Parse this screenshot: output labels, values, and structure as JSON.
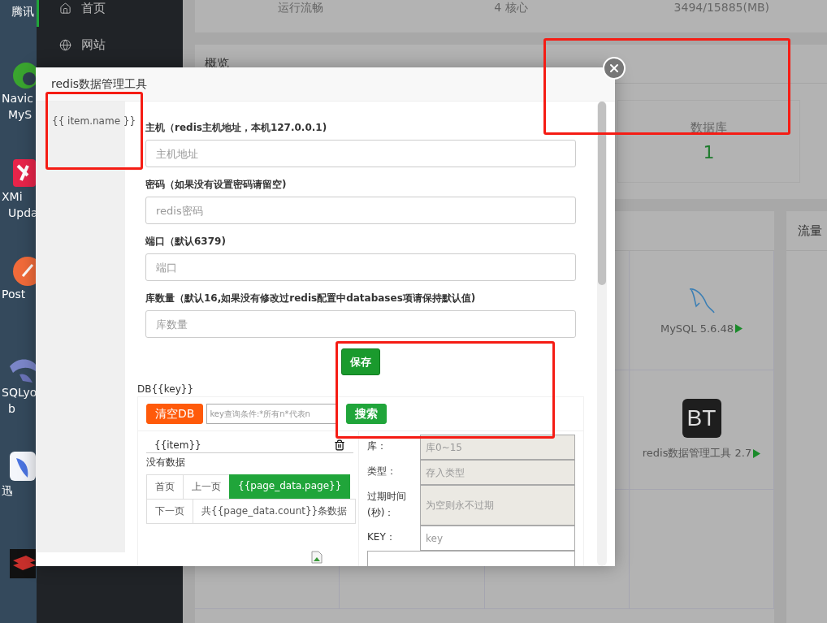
{
  "desktop_icons": [
    {
      "lines": [
        "腾讯"
      ]
    },
    {
      "kind": "green",
      "lines": [
        "Navic",
        "MyS"
      ]
    },
    {
      "kind": "red",
      "lines": [
        "XMi",
        "Upda"
      ]
    },
    {
      "kind": "orange",
      "lines": [
        "Post"
      ]
    },
    {
      "kind": "dolphin",
      "lines": [
        "SQLyo",
        "b"
      ]
    },
    {
      "kind": "bird",
      "lines": [
        "迅"
      ]
    },
    {
      "kind": "stack"
    }
  ],
  "sidebar": {
    "items": [
      {
        "label": "首页",
        "selected": true
      },
      {
        "label": "网站",
        "selected": false
      }
    ]
  },
  "stats": [
    "运行流畅",
    "4 核心",
    "3494/15885(MB)"
  ],
  "overview": {
    "title": "概览",
    "cards": [
      {
        "label": "数据库",
        "value": "1"
      }
    ]
  },
  "software": [
    {
      "name": "MySQL 5.6.48",
      "kind": "dolphin"
    },
    {
      "name": "redis数据管理工具 2.7",
      "kind": "logo",
      "logo_text": "BT"
    }
  ],
  "traffic": {
    "title": "流量"
  },
  "modal": {
    "title": "redis数据管理工具",
    "side_item": "{{ item.name }}",
    "fields": [
      {
        "label": "主机（redis主机地址，本机127.0.0.1)",
        "placeholder": "主机地址"
      },
      {
        "label": "密码（如果没有设置密码请留空)",
        "placeholder": "redis密码"
      },
      {
        "label": "端口（默认6379)",
        "placeholder": "端口"
      },
      {
        "label": "库数量（默认16,如果没有修改过redis配置中databases项请保持默认值)",
        "placeholder": "库数量"
      }
    ],
    "save": "保存",
    "db_title": "DB{{key}}",
    "clear": "清空DB",
    "search_placeholder": "key查询条件:*所有n*代表n",
    "search": "搜索",
    "key_item": "{{item}}",
    "empty": "没有数据",
    "pager": [
      [
        {
          "label": "首页",
          "selected": false
        },
        {
          "label": "上一页",
          "selected": false
        },
        {
          "label": "{{page_data.page}}",
          "selected": true
        }
      ],
      [
        {
          "label": "下一页",
          "selected": false
        },
        {
          "label": "共{{page_data.count}}条数据",
          "selected": false
        }
      ]
    ],
    "detail": [
      {
        "label": "库：",
        "placeholder": "库0~15",
        "disabled": true
      },
      {
        "label": "类型：",
        "placeholder": "存入类型",
        "disabled": true
      },
      {
        "label": "过期时间(秒)：",
        "placeholder": "为空则永不过期",
        "disabled": true
      },
      {
        "label": "KEY：",
        "placeholder": "key",
        "disabled": false
      }
    ]
  }
}
